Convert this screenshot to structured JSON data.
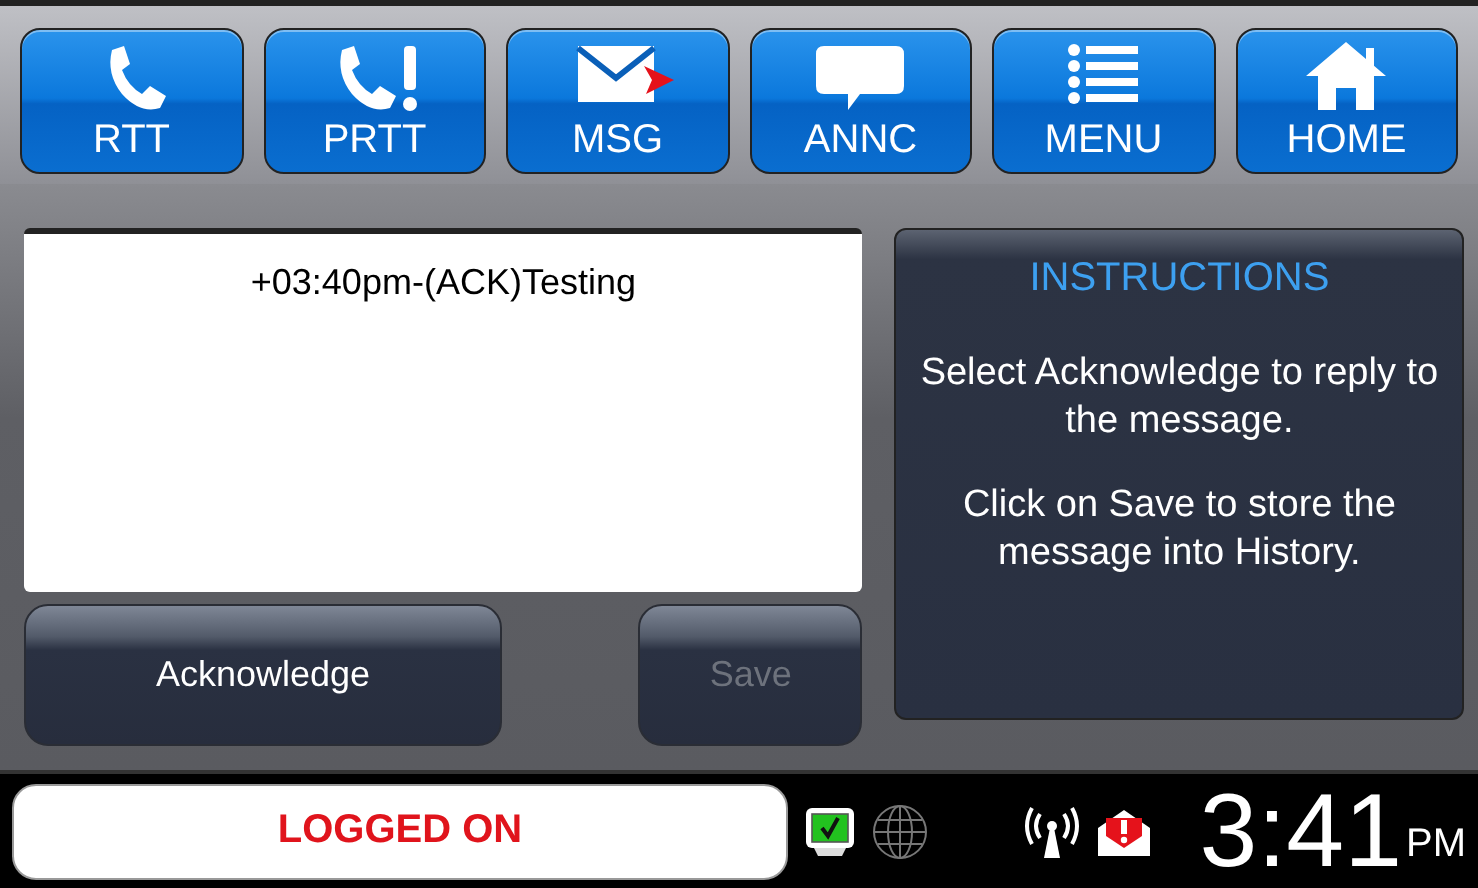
{
  "nav_buttons": [
    {
      "label": "RTT",
      "kind": "phone"
    },
    {
      "label": "PRTT",
      "kind": "phone-alert"
    },
    {
      "label": "MSG",
      "kind": "mail"
    },
    {
      "label": "ANNC",
      "kind": "speech"
    },
    {
      "label": "MENU",
      "kind": "list"
    },
    {
      "label": "HOME",
      "kind": "house"
    }
  ],
  "message": {
    "lines": [
      "+03:40pm-(ACK)Testing"
    ]
  },
  "actions": [
    {
      "label": "Acknowledge",
      "disabled": false
    },
    {
      "label": "Save",
      "disabled": true
    }
  ],
  "instructions": {
    "title": "INSTRUCTIONS",
    "paragraphs": [
      "Select Acknowledge to reply to the message.",
      "Click on Save to store the message into History."
    ]
  },
  "status": {
    "text": "LOGGED ON",
    "time": "3:41",
    "meridiem": "PM"
  }
}
